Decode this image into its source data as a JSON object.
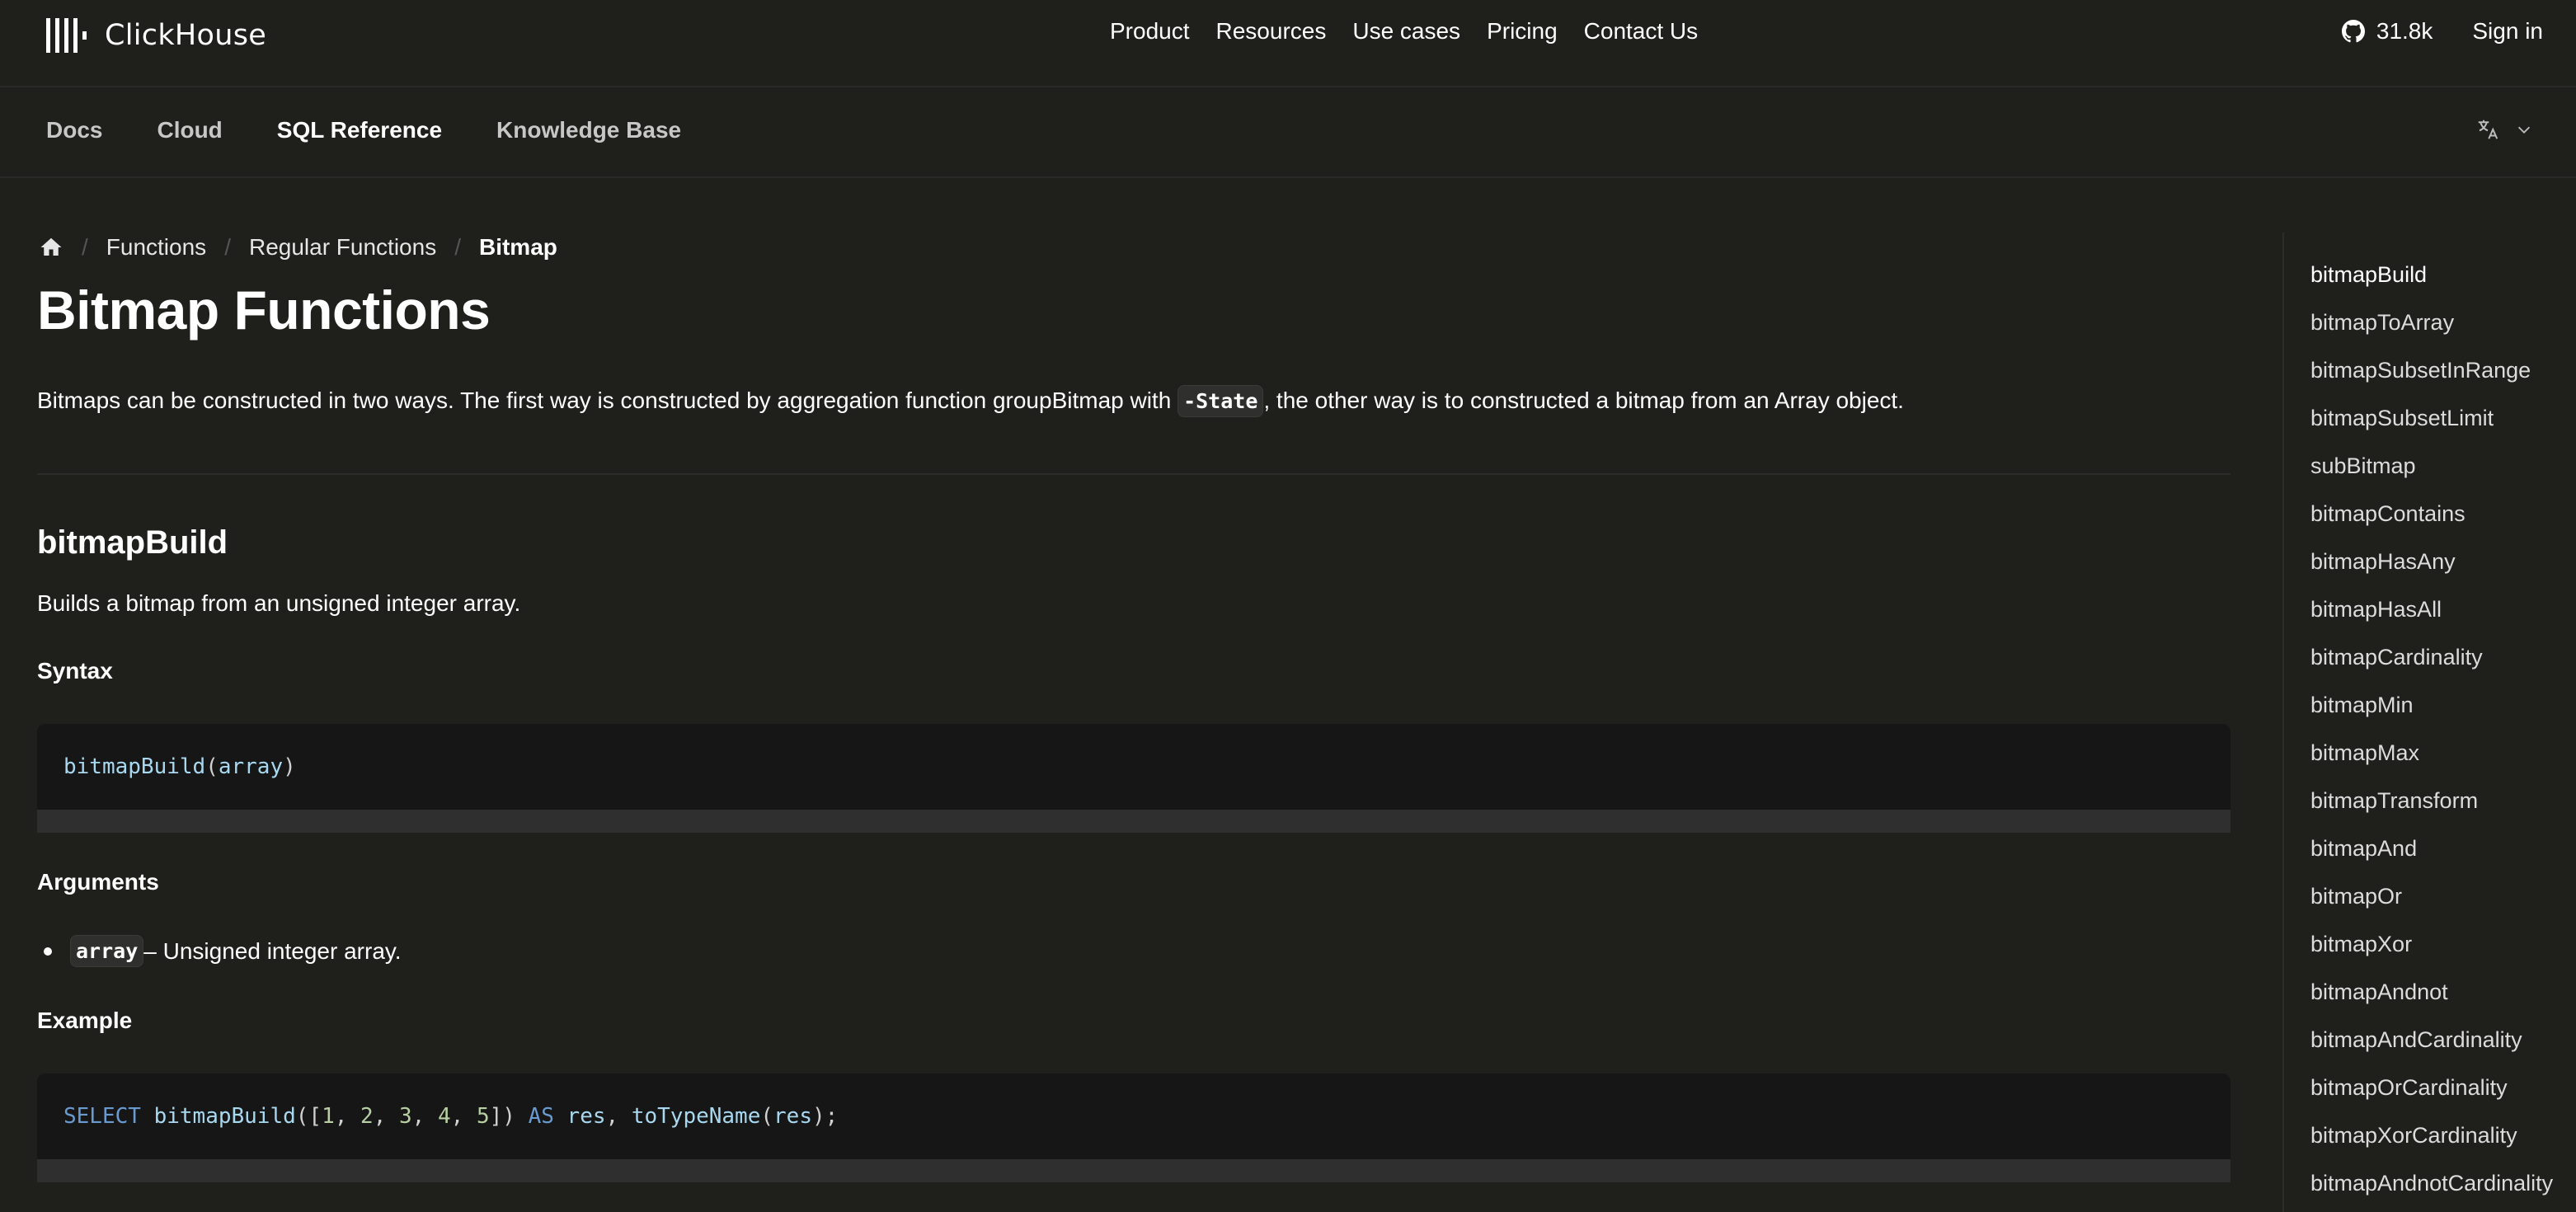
{
  "header": {
    "brand": "ClickHouse",
    "nav": [
      "Product",
      "Resources",
      "Use cases",
      "Pricing",
      "Contact Us"
    ],
    "github_stars": "31.8k",
    "sign_in": "Sign in"
  },
  "tabs": [
    {
      "label": "Docs",
      "active": false
    },
    {
      "label": "Cloud",
      "active": false
    },
    {
      "label": "SQL Reference",
      "active": true
    },
    {
      "label": "Knowledge Base",
      "active": false
    }
  ],
  "language_selector": {
    "icon": "translate-icon"
  },
  "breadcrumb": {
    "items": [
      "Functions",
      "Regular Functions"
    ],
    "current": "Bitmap",
    "separator": "/"
  },
  "page": {
    "title": "Bitmap Functions",
    "intro_before": "Bitmaps can be constructed in two ways. The first way is constructed by aggregation function groupBitmap with ",
    "intro_code": "-State",
    "intro_after": ", the other way is to constructed a bitmap from an Array object."
  },
  "section": {
    "title": "bitmapBuild",
    "description": "Builds a bitmap from an unsigned integer array.",
    "syntax_heading": "Syntax",
    "syntax_code": {
      "fn": "bitmapBuild",
      "open": "(",
      "arg": "array",
      "close": ")"
    },
    "arguments_heading": "Arguments",
    "arguments": [
      {
        "name": "array",
        "description": " – Unsigned integer array."
      }
    ],
    "example_heading": "Example",
    "example_code": {
      "kw_select": "SELECT",
      "fn": "bitmapBuild",
      "open": "([",
      "nums": [
        "1",
        "2",
        "3",
        "4",
        "5"
      ],
      "close": "])",
      "kw_as": "AS",
      "alias": "res",
      "comma": ",",
      "fn2": "toTypeName",
      "open2": "(",
      "arg2": "res",
      "close2": ");"
    }
  },
  "toc": {
    "items": [
      "bitmapBuild",
      "bitmapToArray",
      "bitmapSubsetInRange",
      "bitmapSubsetLimit",
      "subBitmap",
      "bitmapContains",
      "bitmapHasAny",
      "bitmapHasAll",
      "bitmapCardinality",
      "bitmapMin",
      "bitmapMax",
      "bitmapTransform",
      "bitmapAnd",
      "bitmapOr",
      "bitmapXor",
      "bitmapAndnot",
      "bitmapAndCardinality",
      "bitmapOrCardinality",
      "bitmapXorCardinality",
      "bitmapAndnotCardinality"
    ],
    "active_index": 0
  },
  "colors": {
    "background": "#1f1f1c",
    "code_background": "#161616",
    "keyword": "#6a9bd0",
    "function": "#a8d8f0",
    "number": "#b7cfa2"
  }
}
